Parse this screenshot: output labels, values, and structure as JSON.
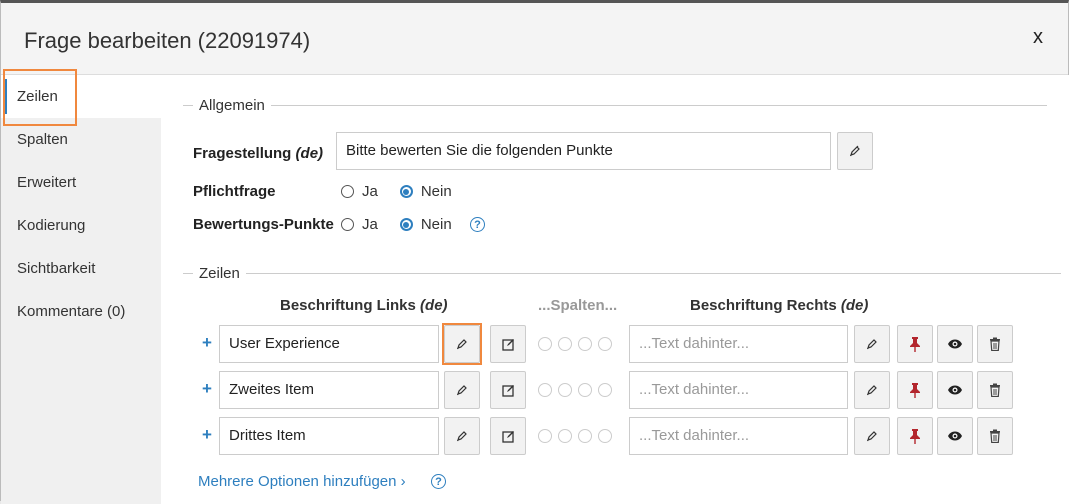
{
  "dialog": {
    "title": "Frage bearbeiten (22091974)",
    "close_label": "x"
  },
  "sidebar": {
    "items": [
      {
        "label": "Zeilen",
        "active": true
      },
      {
        "label": "Spalten"
      },
      {
        "label": "Erweitert"
      },
      {
        "label": "Kodierung"
      },
      {
        "label": "Sichtbarkeit"
      },
      {
        "label": "Kommentare (0)"
      }
    ]
  },
  "allgemein": {
    "legend": "Allgemein",
    "fragestellung_label": "Fragestellung",
    "lang_suffix": "(de)",
    "fragestellung_value": "Bitte bewerten Sie die folgenden Punkte",
    "pflichtfrage_label": "Pflichtfrage",
    "bewertung_label": "Bewertungs-Punkte",
    "ja": "Ja",
    "nein": "Nein"
  },
  "zeilen": {
    "legend": "Zeilen",
    "col_left": "Beschriftung Links",
    "col_spalten": "...Spalten...",
    "col_right": "Beschriftung Rechts",
    "lang_suffix": "(de)",
    "right_placeholder": "...Text dahinter...",
    "rows": [
      {
        "left": "User Experience"
      },
      {
        "left": "Zweites Item"
      },
      {
        "left": "Drittes Item"
      }
    ],
    "add_more": "Mehrere Optionen hinzufügen ›"
  },
  "colors": {
    "accent": "#2e7fbf",
    "highlight": "#f0883e",
    "pin": "#b3262d"
  }
}
